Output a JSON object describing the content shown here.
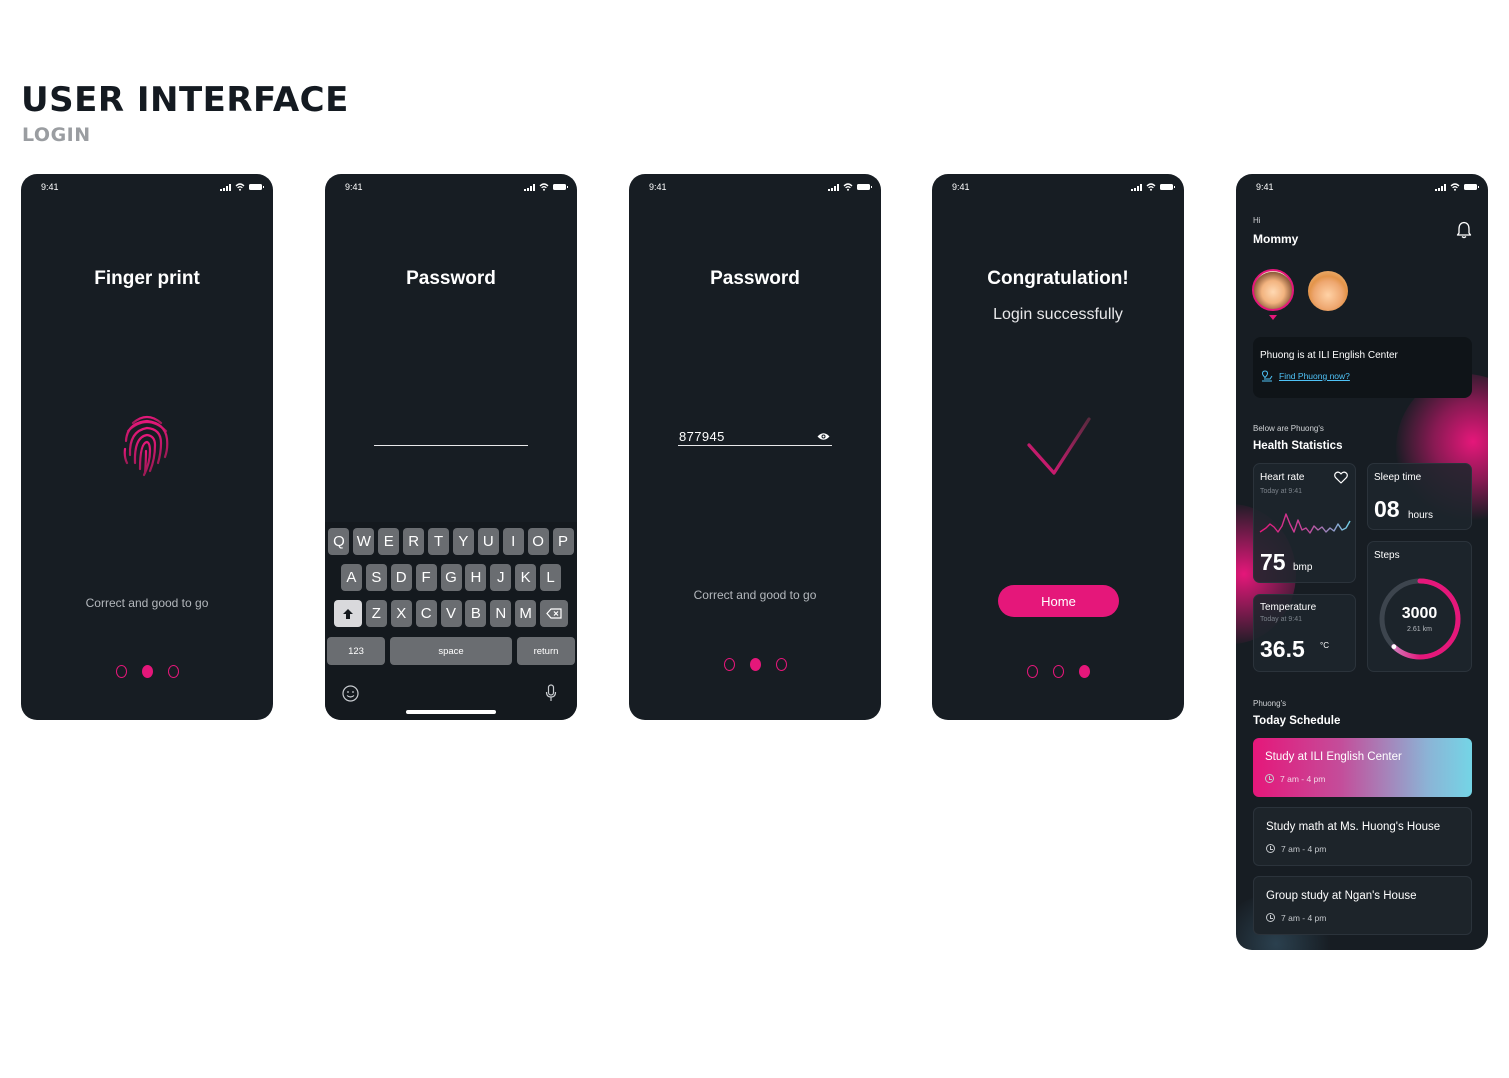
{
  "header": {
    "title": "USER INTERFACE",
    "subtitle": "LOGIN"
  },
  "status_time": "9:41",
  "screen1": {
    "title": "Finger print",
    "caption": "Correct and good to go"
  },
  "screen2": {
    "title": "Password",
    "keyboard": {
      "row1": [
        "Q",
        "W",
        "E",
        "R",
        "T",
        "Y",
        "U",
        "I",
        "O",
        "P"
      ],
      "row2": [
        "A",
        "S",
        "D",
        "F",
        "G",
        "H",
        "J",
        "K",
        "L"
      ],
      "row3": [
        "Z",
        "X",
        "C",
        "V",
        "B",
        "N",
        "M"
      ],
      "key_123": "123",
      "key_space": "space",
      "key_return": "return"
    }
  },
  "screen3": {
    "title": "Password",
    "value": "877945",
    "caption": "Correct and good to go"
  },
  "screen4": {
    "title": "Congratulation!",
    "subtitle": "Login successfully",
    "button": "Home"
  },
  "dashboard": {
    "greeting": "Hi",
    "name": "Mommy",
    "location": {
      "title": "Phuong is at ILI English Center",
      "link": "Find Phuong now?"
    },
    "stats_pre": "Below are Phuong's",
    "stats_title": "Health Statistics",
    "heart": {
      "label": "Heart rate",
      "time": "Today at 9:41",
      "value": "75",
      "unit": "bmp"
    },
    "sleep": {
      "label": "Sleep time",
      "value": "08",
      "unit": "hours"
    },
    "temperature": {
      "label": "Temperature",
      "time": "Today at 9:41",
      "value": "36.5",
      "unit": "°C"
    },
    "steps": {
      "label": "Steps",
      "value": "3000",
      "distance": "2.61 km",
      "progress": 0.62
    },
    "schedule_pre": "Phuong's",
    "schedule_title": "Today Schedule",
    "schedule": [
      {
        "title": "Study at ILI English Center",
        "time": "7 am - 4 pm"
      },
      {
        "title": "Study math at Ms. Huong's House",
        "time": "7 am - 4 pm"
      },
      {
        "title": "Group study at Ngan's House",
        "time": "7 am - 4 pm"
      }
    ]
  },
  "colors": {
    "accent": "#e5177a",
    "phone_bg": "#171d23",
    "page_bg": "#ffffff",
    "link": "#4fc3f7"
  },
  "pager": {
    "screen1_active": 2,
    "screen3_active": 2,
    "screen4_active": 3,
    "total": 3
  }
}
